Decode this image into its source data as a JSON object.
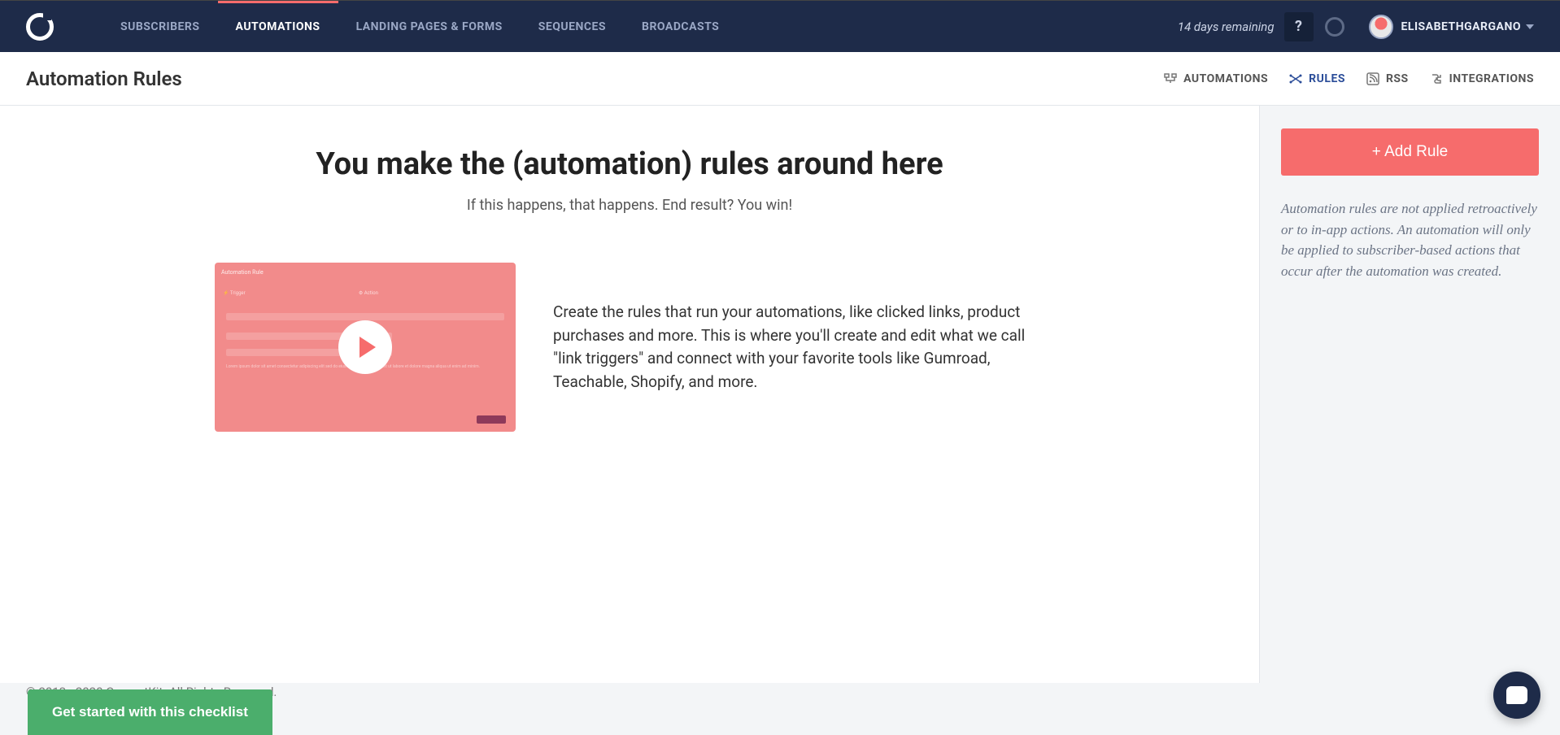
{
  "nav": {
    "items": [
      {
        "label": "SUBSCRIBERS"
      },
      {
        "label": "AUTOMATIONS"
      },
      {
        "label": "LANDING PAGES & FORMS"
      },
      {
        "label": "SEQUENCES"
      },
      {
        "label": "BROADCASTS"
      }
    ],
    "trial_text": "14 days remaining",
    "help_label": "?",
    "username": "ELISABETHGARGANO"
  },
  "subhead": {
    "title": "Automation Rules",
    "tabs": [
      {
        "label": "AUTOMATIONS"
      },
      {
        "label": "RULES"
      },
      {
        "label": "RSS"
      },
      {
        "label": "INTEGRATIONS"
      }
    ]
  },
  "hero": {
    "headline": "You make the (automation) rules around here",
    "subline": "If this happens, that happens. End result? You win!",
    "description": "Create the rules that run your automations, like clicked links, product purchases and more. This is where you'll create and edit what we call \"link triggers\" and connect with your favorite tools like Gumroad, Teachable, Shopify, and more."
  },
  "sidebar": {
    "add_rule_label": "+ Add Rule",
    "note": "Automation rules are not applied retroactively or to in-app actions. An automation will only be applied to subscriber-based actions that occur after the automation was created."
  },
  "footer": {
    "copyright": "© 2013 - 2020 ConvertKit. All Rights Reserved.",
    "checklist_label": "Get started with this checklist"
  }
}
